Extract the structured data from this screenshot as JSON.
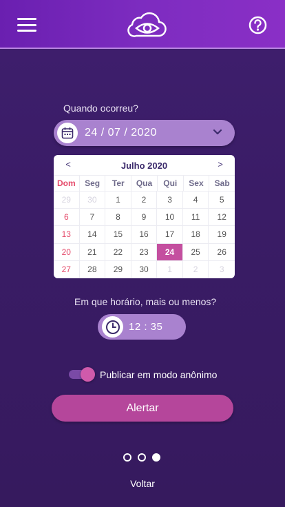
{
  "header": {
    "menu_icon": "hamburger-menu-icon",
    "logo_icon": "cloud-eye-logo",
    "help_icon": "question-circle-icon",
    "accent": "#7d2cc0"
  },
  "date_section": {
    "label": "Quando ocorreu?",
    "value": "24 / 07 / 2020",
    "icon": "calendar-icon",
    "dropdown_icon": "chevron-down-icon"
  },
  "calendar": {
    "prev": "<",
    "next": ">",
    "title": "Julho 2020",
    "weekdays": [
      "Dom",
      "Seg",
      "Ter",
      "Qua",
      "Qui",
      "Sex",
      "Sab"
    ],
    "days": [
      {
        "label": "29",
        "muted": true
      },
      {
        "label": "30",
        "muted": true
      },
      {
        "label": "1"
      },
      {
        "label": "2"
      },
      {
        "label": "3"
      },
      {
        "label": "4"
      },
      {
        "label": "5"
      },
      {
        "label": "6"
      },
      {
        "label": "7"
      },
      {
        "label": "8"
      },
      {
        "label": "9"
      },
      {
        "label": "10"
      },
      {
        "label": "11"
      },
      {
        "label": "12"
      },
      {
        "label": "13"
      },
      {
        "label": "14"
      },
      {
        "label": "15"
      },
      {
        "label": "16"
      },
      {
        "label": "17"
      },
      {
        "label": "18"
      },
      {
        "label": "19"
      },
      {
        "label": "20"
      },
      {
        "label": "21"
      },
      {
        "label": "22"
      },
      {
        "label": "23"
      },
      {
        "label": "24",
        "selected": true
      },
      {
        "label": "25"
      },
      {
        "label": "26"
      },
      {
        "label": "27"
      },
      {
        "label": "28"
      },
      {
        "label": "29"
      },
      {
        "label": "30"
      },
      {
        "label": "1",
        "muted": true
      },
      {
        "label": "2",
        "muted": true
      },
      {
        "label": "3",
        "muted": true
      }
    ],
    "selected_color": "#c44f9f",
    "sunday_color": "#e54b6b"
  },
  "time_section": {
    "label": "Em que horário, mais ou menos?",
    "value": "12 : 35",
    "icon": "clock-icon"
  },
  "anonymous": {
    "label": "Publicar em modo anônimo",
    "enabled": true
  },
  "actions": {
    "alert_label": "Alertar",
    "back_label": "Voltar"
  },
  "pagination": {
    "total": 3,
    "current": 3
  }
}
